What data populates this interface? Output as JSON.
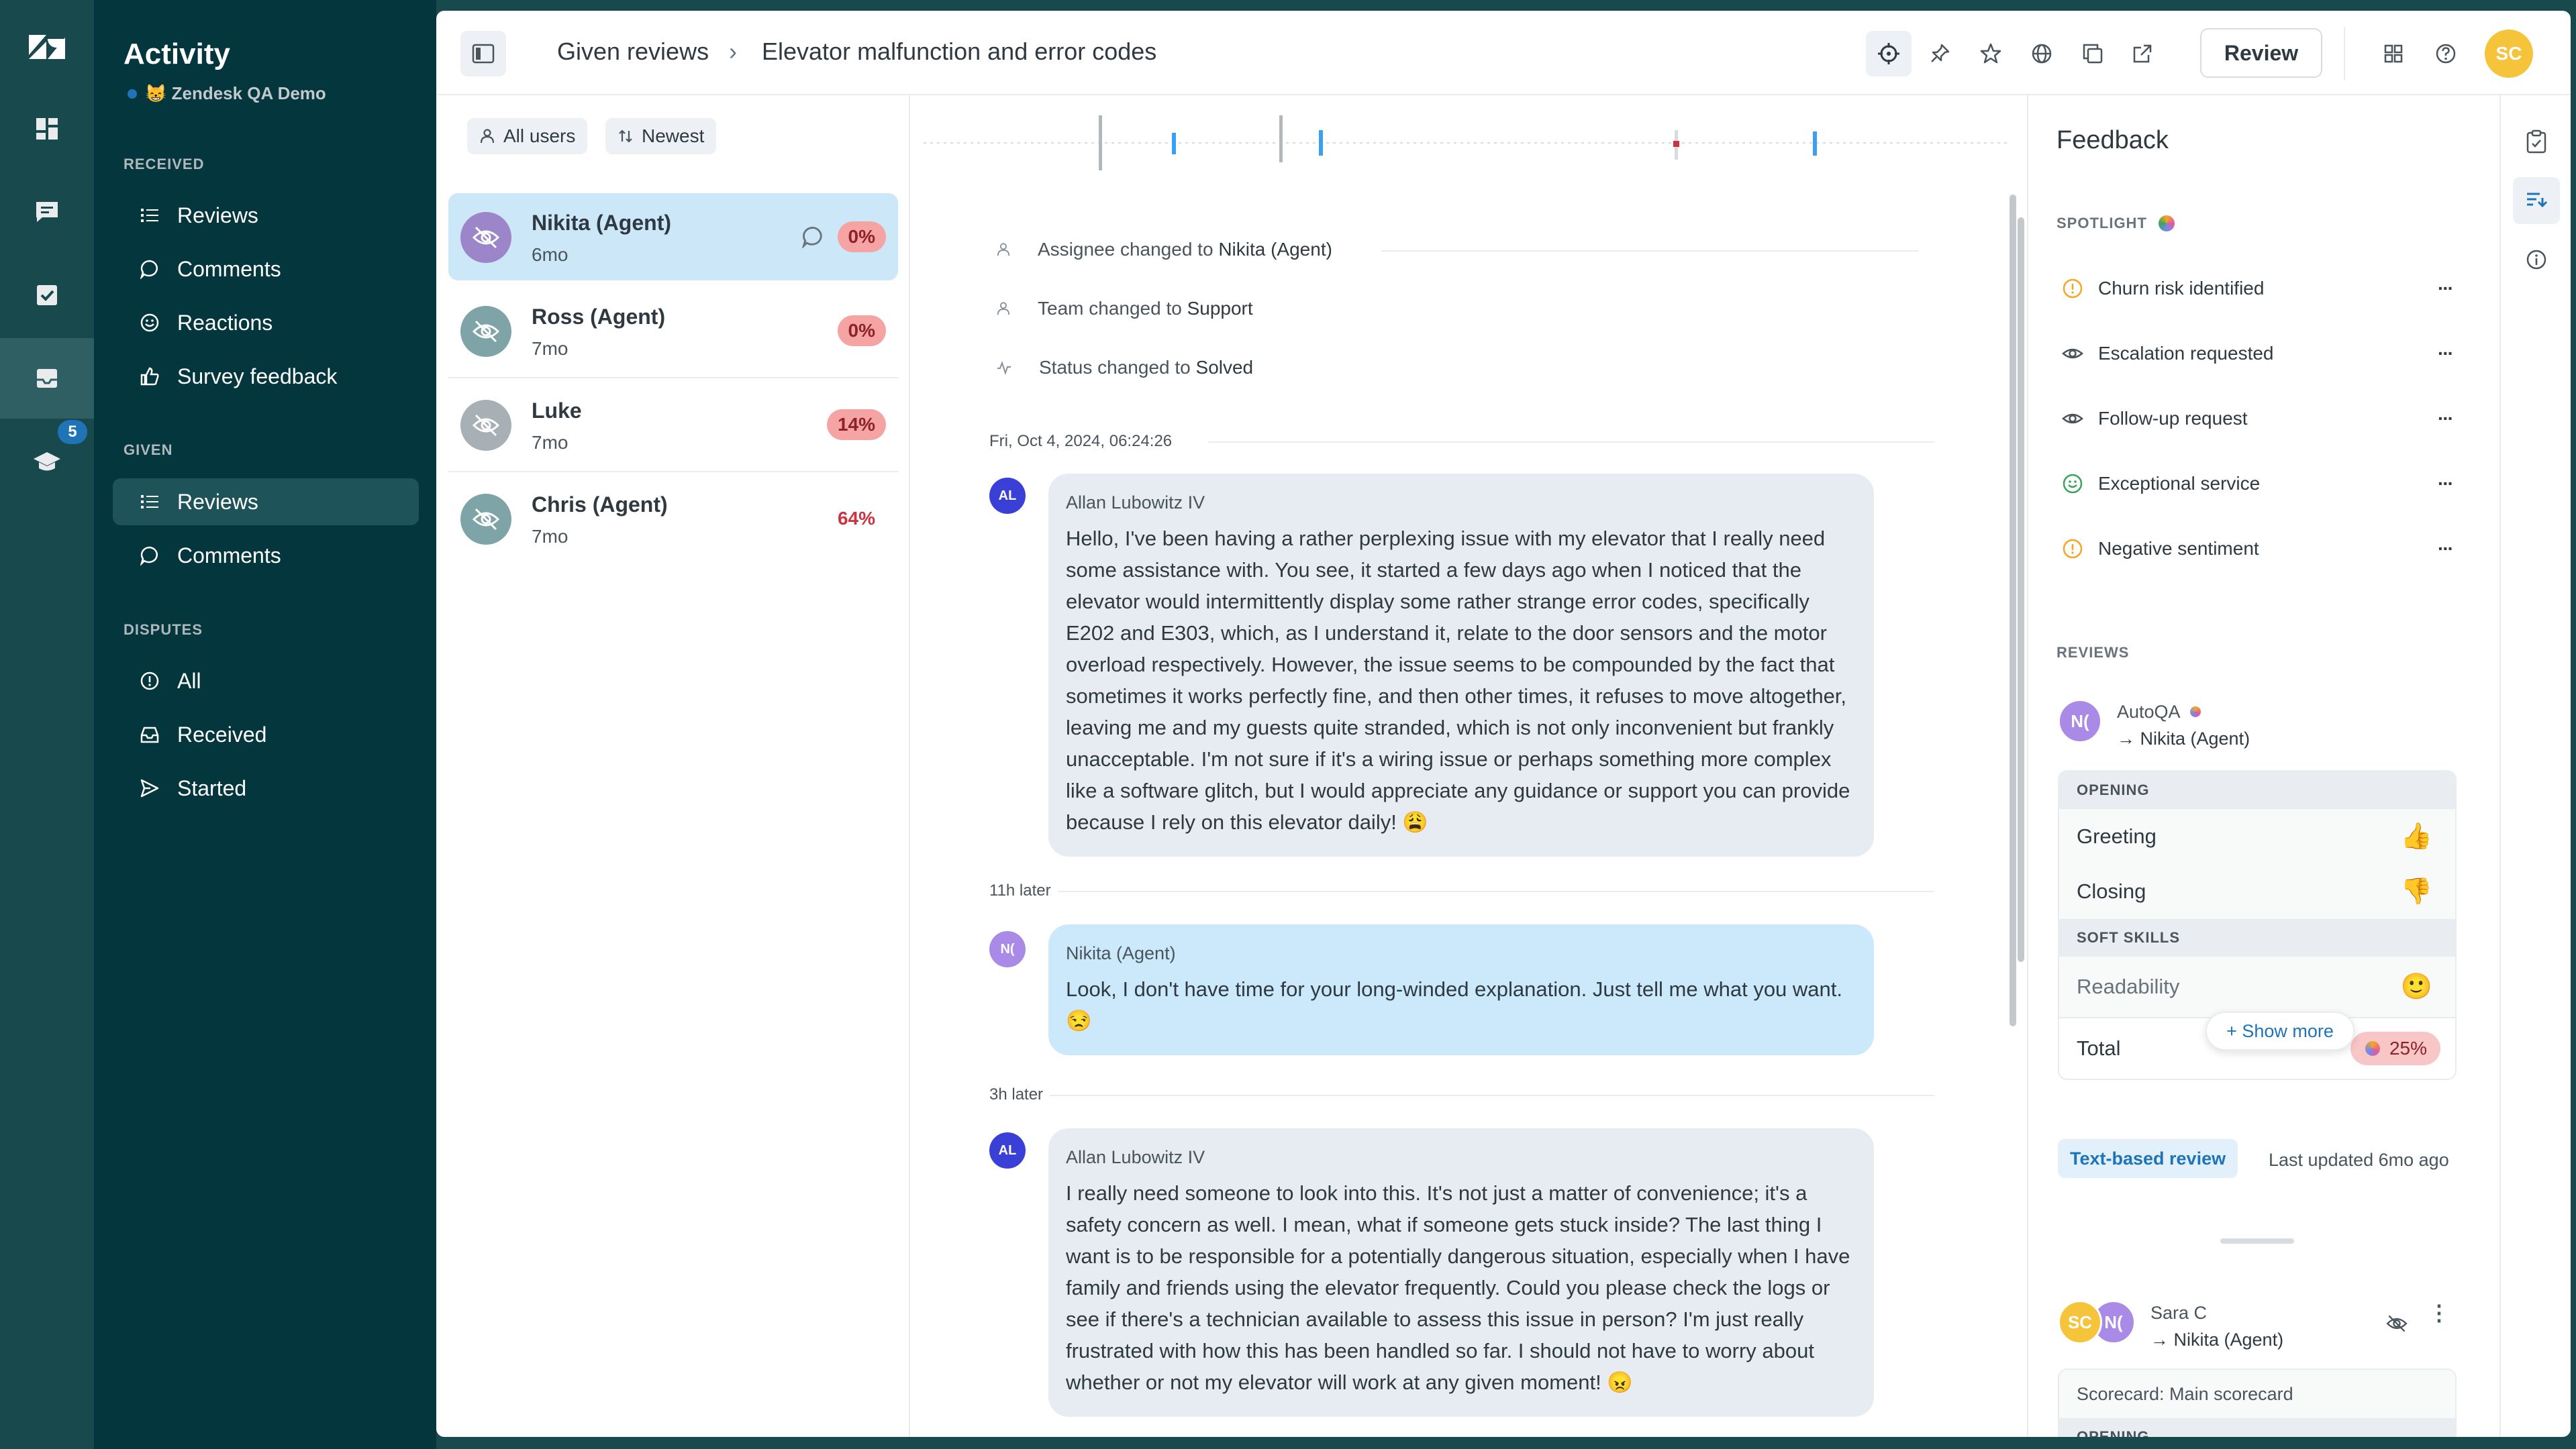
{
  "colors": {
    "accent": "#1f73b7",
    "sidebar": "#03363d",
    "rail": "#17494d",
    "agent_bubble": "#cbe9fb",
    "customer_bubble": "#e7ecf3",
    "score_bad": "#cc3340"
  },
  "nav": {
    "title": "Activity",
    "subtitle": "😸 Zendesk QA Demo",
    "rail_badge": "5",
    "received_header": "RECEIVED",
    "received": [
      {
        "label": "Reviews",
        "icon": "list-icon"
      },
      {
        "label": "Comments",
        "icon": "comment-icon"
      },
      {
        "label": "Reactions",
        "icon": "smiley-icon"
      },
      {
        "label": "Survey feedback",
        "icon": "thumbs-up-icon"
      }
    ],
    "given_header": "GIVEN",
    "given": [
      {
        "label": "Reviews",
        "icon": "list-icon",
        "active": true
      },
      {
        "label": "Comments",
        "icon": "comment-icon"
      }
    ],
    "disputes_header": "DISPUTES",
    "disputes": [
      {
        "label": "All",
        "icon": "alert-icon"
      },
      {
        "label": "Received",
        "icon": "inbox-icon"
      },
      {
        "label": "Started",
        "icon": "send-icon"
      }
    ]
  },
  "topbar": {
    "crumb_parent": "Given reviews",
    "crumb_current": "Elevator malfunction and error codes",
    "review_button": "Review",
    "avatar_initials": "SC"
  },
  "list": {
    "filter_users": "All users",
    "sort": "Newest",
    "rows": [
      {
        "name": "Nikita (Agent)",
        "time": "6mo",
        "score": "0%",
        "selected": true
      },
      {
        "name": "Ross (Agent)",
        "time": "7mo",
        "score": "0%"
      },
      {
        "name": "Luke",
        "time": "7mo",
        "score": "14%"
      },
      {
        "name": "Chris (Agent)",
        "time": "7mo",
        "score": "64%"
      }
    ]
  },
  "conversation": {
    "events": [
      {
        "prefix": "Assignee changed to",
        "value": "Nikita (Agent)"
      },
      {
        "prefix": "Team changed to",
        "value": "Support"
      },
      {
        "prefix": "Status changed to",
        "value": "Solved"
      }
    ],
    "timestamp1": "Fri, Oct 4, 2024, 06:24:26",
    "msg1": {
      "initials": "AL",
      "author": "Allan Lubowitz IV",
      "text": "Hello, I've been having a rather perplexing issue with my elevator that I really need some assistance with. You see, it started a few days ago when I noticed that the elevator would intermittently display some rather strange error codes, specifically E202 and E303, which, as I understand it, relate to the door sensors and the motor overload respectively. However, the issue seems to be compounded by the fact that sometimes it works perfectly fine, and then other times, it refuses to move altogether, leaving me and my guests quite stranded, which is not only inconvenient but frankly unacceptable. I'm not sure if it's a wiring issue or perhaps something more complex like a software glitch, but I would appreciate any guidance or support you can provide because I rely on this elevator daily! 😩"
    },
    "gap1": "11h later",
    "msg2": {
      "initials": "N(",
      "author": "Nikita (Agent)",
      "text": "Look, I don't have time for your long-winded explanation. Just tell me what you want. 😒"
    },
    "gap2": "3h later",
    "msg3": {
      "initials": "AL",
      "author": "Allan Lubowitz IV",
      "text": "I really need someone to look into this. It's not just a matter of convenience; it's a safety concern as well. I mean, what if someone gets stuck inside? The last thing I want is to be responsible for a potentially dangerous situation, especially when I have family and friends using the elevator frequently. Could you please check the logs or see if there's a technician available to assess this issue in person? I'm just really frustrated with how this has been handled so far. I should not have to worry about whether or not my elevator will work at any given moment! 😠"
    }
  },
  "feedback": {
    "title": "Feedback",
    "spotlight_header": "SPOTLIGHT",
    "spotlight": [
      {
        "label": "Churn risk identified",
        "icon": "warning-circle-icon",
        "color": "#f5a623"
      },
      {
        "label": "Escalation requested",
        "icon": "eye-icon",
        "color": "#49545c"
      },
      {
        "label": "Follow-up request",
        "icon": "eye-icon",
        "color": "#49545c"
      },
      {
        "label": "Exceptional service",
        "icon": "smiley-icon",
        "color": "#3aa35c"
      },
      {
        "label": "Negative sentiment",
        "icon": "warning-circle-icon",
        "color": "#f5a623"
      }
    ],
    "reviews_header": "REVIEWS",
    "review1": {
      "initials": "N(",
      "reviewer": "AutoQA",
      "reviewee": "→ Nikita (Agent)",
      "section1": "OPENING",
      "cat1": "Greeting",
      "cat1_emoji": "👍",
      "cat2": "Closing",
      "cat2_emoji": "👎",
      "section2": "SOFT SKILLS",
      "cat3": "Readability",
      "cat3_emoji": "🙂",
      "show_more": "+ Show more",
      "total_label": "Total",
      "total_value": "25%"
    },
    "tag": "Text-based review",
    "updated": "Last updated 6mo ago",
    "review2": {
      "initials1": "SC",
      "initials2": "N(",
      "reviewer": "Sara C",
      "reviewee": "→ Nikita (Agent)",
      "scorecard": "Scorecard: Main scorecard",
      "section1": "OPENING"
    }
  }
}
